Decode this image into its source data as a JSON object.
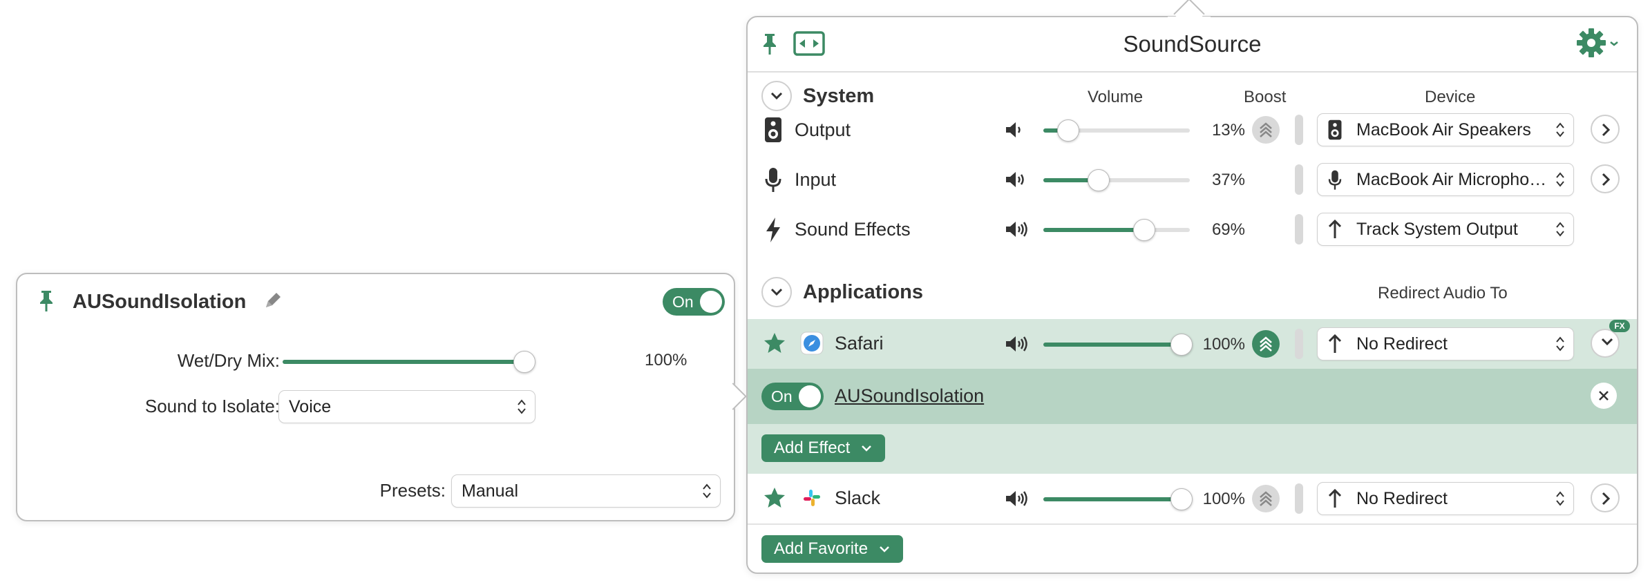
{
  "window": {
    "title": "SoundSource"
  },
  "system": {
    "heading": "System",
    "columns": {
      "volume": "Volume",
      "boost": "Boost",
      "device": "Device"
    },
    "rows": [
      {
        "label": "Output",
        "percent": "13%",
        "level": 0.13,
        "device": "MacBook Air Speakers"
      },
      {
        "label": "Input",
        "percent": "37%",
        "level": 0.37,
        "device": "MacBook Air Micropho…"
      },
      {
        "label": "Sound Effects",
        "percent": "69%",
        "level": 0.69,
        "device": "Track System Output"
      }
    ]
  },
  "applications": {
    "heading": "Applications",
    "redirect_column": "Redirect Audio To",
    "rows": [
      {
        "name": "Safari",
        "percent": "100%",
        "level": 1.0,
        "redirect": "No Redirect",
        "fx_badge": "FX"
      },
      {
        "name": "Slack",
        "percent": "100%",
        "level": 1.0,
        "redirect": "No Redirect"
      }
    ],
    "effect": {
      "toggle_label": "On",
      "name": "AUSoundIsolation"
    },
    "add_effect_label": "Add Effect",
    "add_favorite_label": "Add Favorite"
  },
  "fx_panel": {
    "title": "AUSoundIsolation",
    "toggle_label": "On",
    "wet_dry_label": "Wet/Dry Mix:",
    "wet_dry_value": "100%",
    "wet_dry_level": 1.0,
    "isolate_label": "Sound to Isolate:",
    "isolate_value": "Voice",
    "presets_label": "Presets:",
    "presets_value": "Manual"
  },
  "colors": {
    "accent": "#3c8a64",
    "selected_row": "#d6e7dd",
    "effect_row": "#b7d4c4"
  }
}
